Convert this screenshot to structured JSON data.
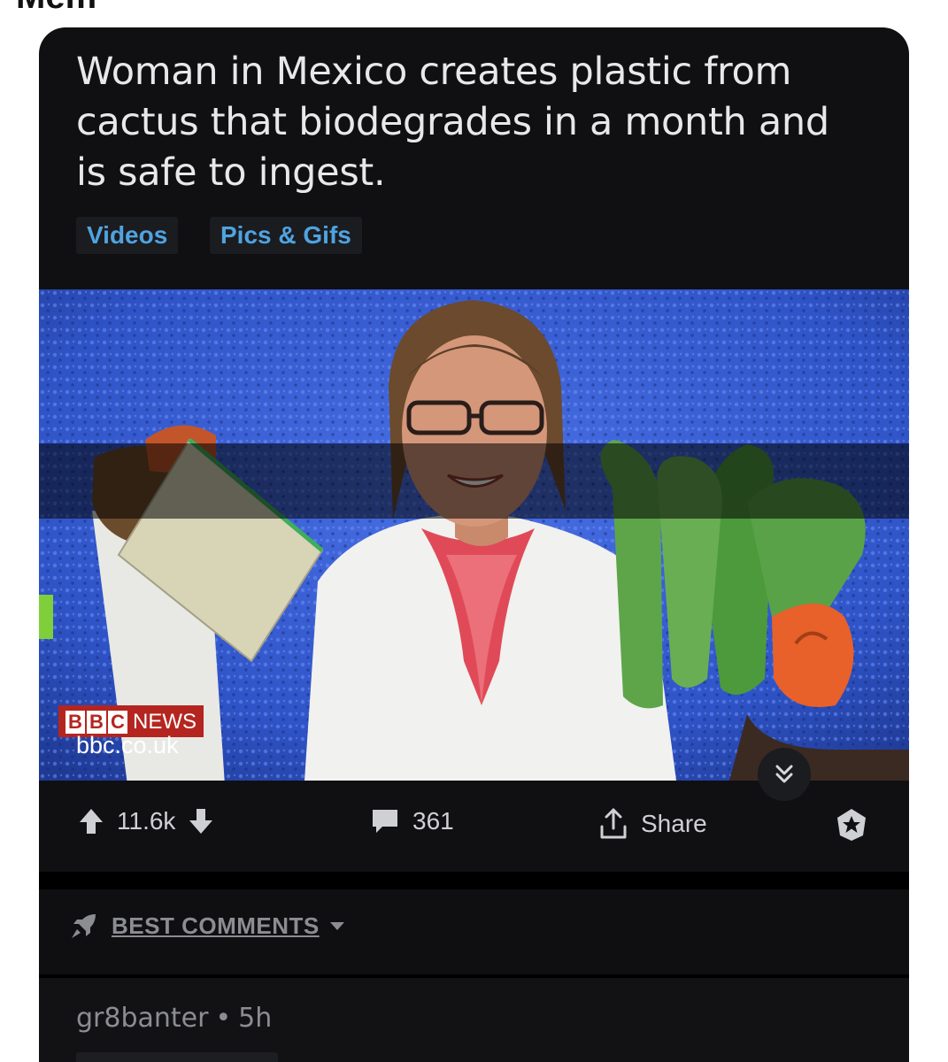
{
  "page": {
    "top_cut_text": "Mem"
  },
  "post": {
    "title": "Woman in Mexico creates plastic from cactus that biodegrades in a month and is safe to ingest.",
    "flairs": [
      "Videos",
      "Pics & Gifs"
    ],
    "source": {
      "brand_letters": [
        "B",
        "B",
        "C"
      ],
      "brand_name": "NEWS",
      "domain": "bbc.co.uk"
    },
    "upvotes": "11.6k",
    "comments_count": "361",
    "share_label": "Share"
  },
  "comments": {
    "sort_label": "BEST COMMENTS",
    "first": {
      "author": "gr8banter",
      "separator": "•",
      "age": "5h"
    }
  },
  "colors": {
    "card_bg": "#101012",
    "flair_text": "#4fa3e0",
    "bbc_red": "#b5251f",
    "text_muted": "#8c8d92"
  },
  "icons": {
    "upvote": "arrow-up-icon",
    "downvote": "arrow-down-icon",
    "comments": "speech-bubble-icon",
    "share": "share-upload-icon",
    "award": "award-badge-icon",
    "expand": "double-chevron-down-icon",
    "sort": "rocket-icon",
    "sort_dropdown": "caret-down-icon"
  }
}
